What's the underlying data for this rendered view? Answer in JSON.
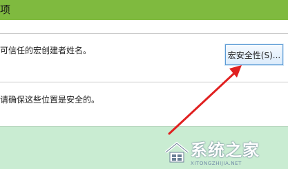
{
  "dialog": {
    "title_partial": "项"
  },
  "trusted_publishers": {
    "description_partial": "可信任的宏创建者姓名。",
    "macro_security_button": "宏安全性(S)..."
  },
  "trusted_locations": {
    "description_partial": "请确保这些位置是安全的。"
  },
  "annotation": {
    "arrow_color": "#e02020"
  },
  "watermark": {
    "brand": "系统之家",
    "url": "XITONGZHIJIA.NET"
  },
  "colors": {
    "title_bar": "#7fba3f",
    "panel": "#c9ecd2",
    "button_border": "#5b9bd5"
  }
}
